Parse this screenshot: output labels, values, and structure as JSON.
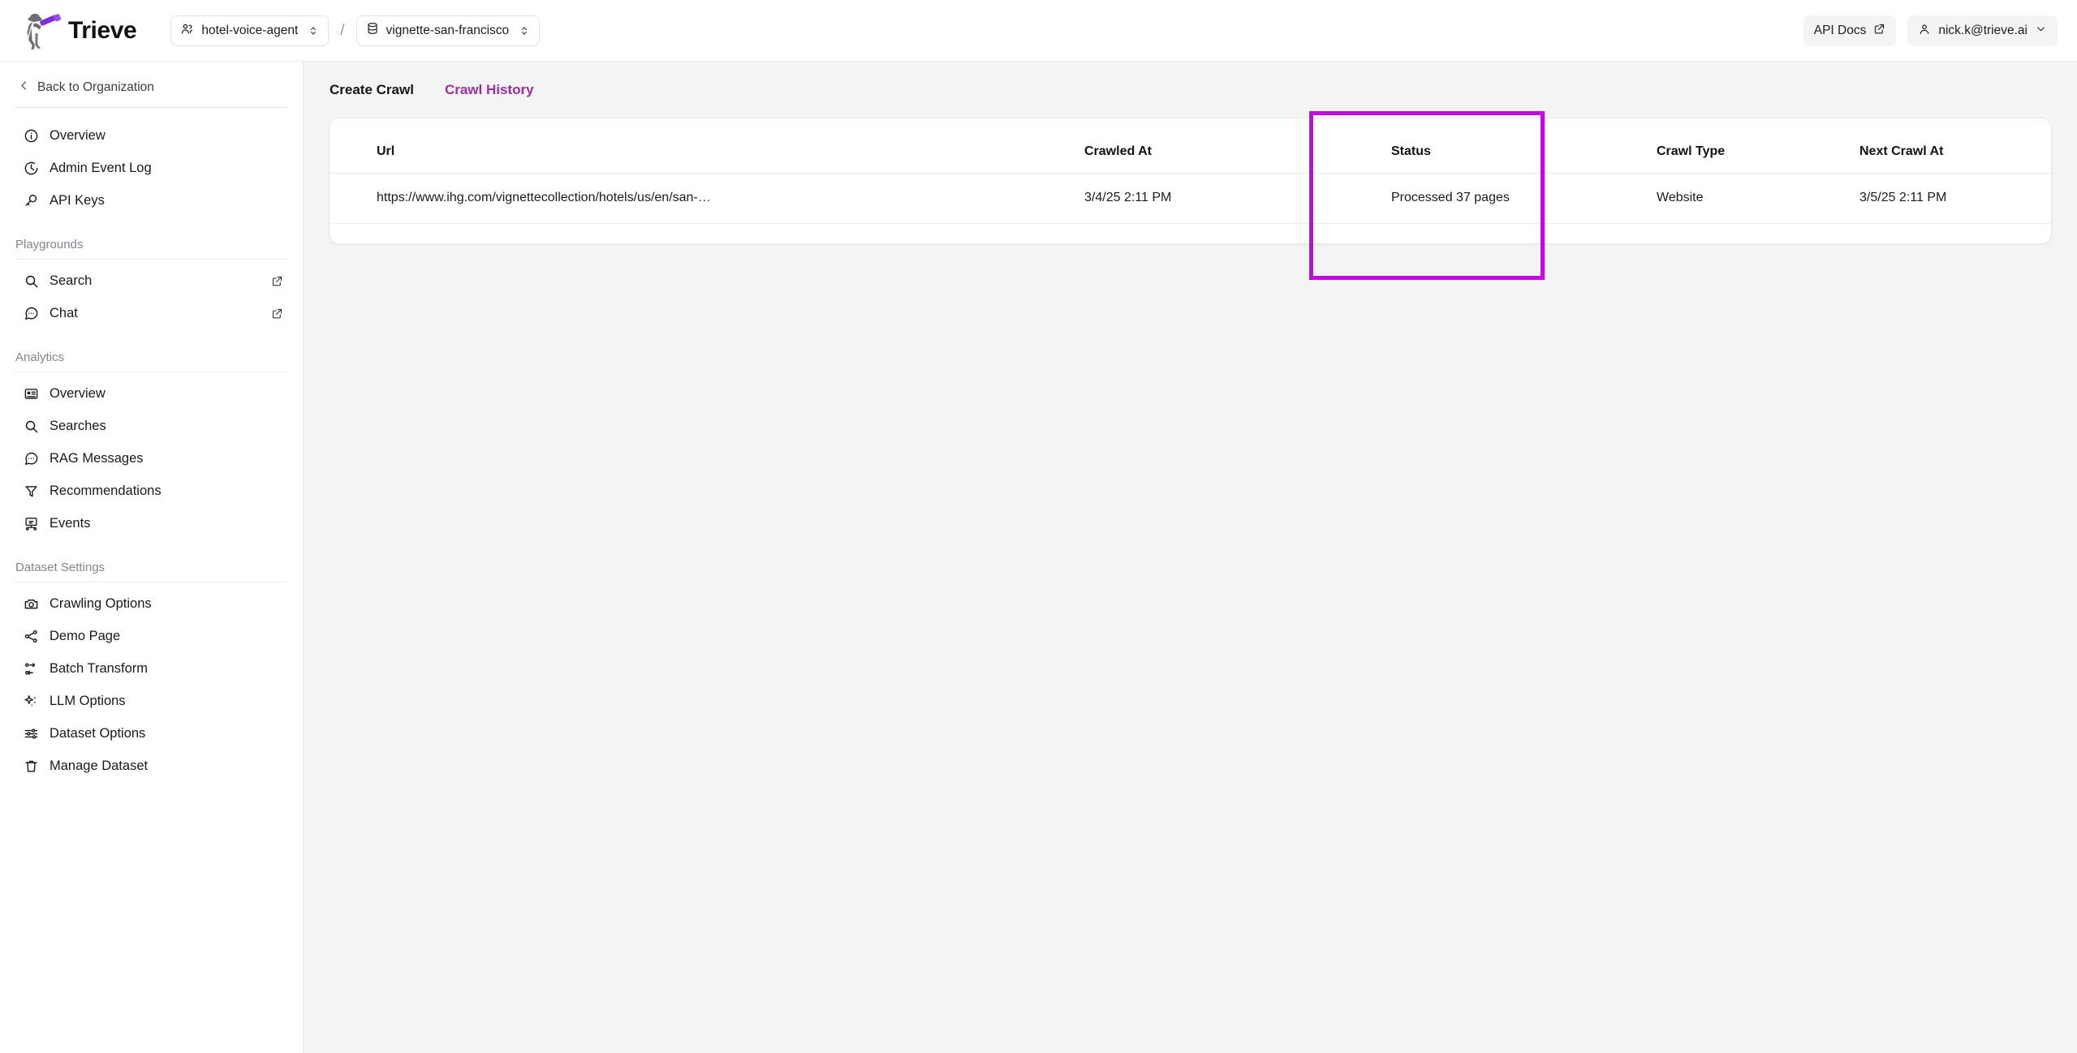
{
  "brand": {
    "name": "Trieve",
    "logo_icon": "trieve-telescope-logo"
  },
  "header": {
    "org_selector": {
      "label": "hotel-voice-agent",
      "icon": "users-icon",
      "chevron_icon": "chevron-up-down-icon"
    },
    "separator": "/",
    "dataset_selector": {
      "label": "vignette-san-francisco",
      "icon": "database-icon",
      "chevron_icon": "chevron-up-down-icon"
    },
    "api_docs": {
      "label": "API Docs",
      "icon": "external-link-icon"
    },
    "account": {
      "label": "nick.k@trieve.ai",
      "icon": "user-icon",
      "chevron_icon": "chevron-down-icon"
    }
  },
  "sidebar": {
    "back": {
      "label": "Back to Organization",
      "icon": "chevron-left-icon"
    },
    "primary_items": [
      {
        "label": "Overview",
        "icon": "info-circle-icon"
      },
      {
        "label": "Admin Event Log",
        "icon": "clock-history-icon"
      },
      {
        "label": "API Keys",
        "icon": "key-icon"
      }
    ],
    "groups": [
      {
        "label": "Playgrounds",
        "items": [
          {
            "label": "Search",
            "icon": "search-icon",
            "external_icon": "external-link-icon"
          },
          {
            "label": "Chat",
            "icon": "chat-bubble-icon",
            "external_icon": "external-link-icon"
          }
        ]
      },
      {
        "label": "Analytics",
        "items": [
          {
            "label": "Overview",
            "icon": "dashboard-icon"
          },
          {
            "label": "Searches",
            "icon": "search-icon"
          },
          {
            "label": "RAG Messages",
            "icon": "chat-bubble-icon"
          },
          {
            "label": "Recommendations",
            "icon": "funnel-icon"
          },
          {
            "label": "Events",
            "icon": "events-node-icon"
          }
        ]
      },
      {
        "label": "Dataset Settings",
        "items": [
          {
            "label": "Crawling Options",
            "icon": "camera-icon"
          },
          {
            "label": "Demo Page",
            "icon": "share-nodes-icon"
          },
          {
            "label": "Batch Transform",
            "icon": "shuffle-icon"
          },
          {
            "label": "LLM Options",
            "icon": "sparkles-icon"
          },
          {
            "label": "Dataset Options",
            "icon": "sliders-icon"
          },
          {
            "label": "Manage Dataset",
            "icon": "trash-icon"
          }
        ]
      }
    ]
  },
  "main": {
    "tabs": [
      {
        "label": "Create Crawl",
        "active": false
      },
      {
        "label": "Crawl History",
        "active": true
      }
    ],
    "table": {
      "columns": [
        "Url",
        "Crawled At",
        "Status",
        "Crawl Type",
        "Next Crawl At"
      ],
      "rows": [
        {
          "url": "https://www.ihg.com/vignettecollection/hotels/us/en/san-…",
          "crawled_at": "3/4/25 2:11 PM",
          "status": "Processed 37 pages",
          "crawl_type": "Website",
          "next_crawl_at": "3/5/25 2:11 PM"
        }
      ]
    }
  },
  "annotation": {
    "highlight_color": "#c00ae0",
    "target_column": "Status"
  },
  "colors": {
    "accent": "#9b2fa0",
    "page_background": "#f4f4f5",
    "panel_background": "#ffffff",
    "border": "#e7e7ea"
  }
}
